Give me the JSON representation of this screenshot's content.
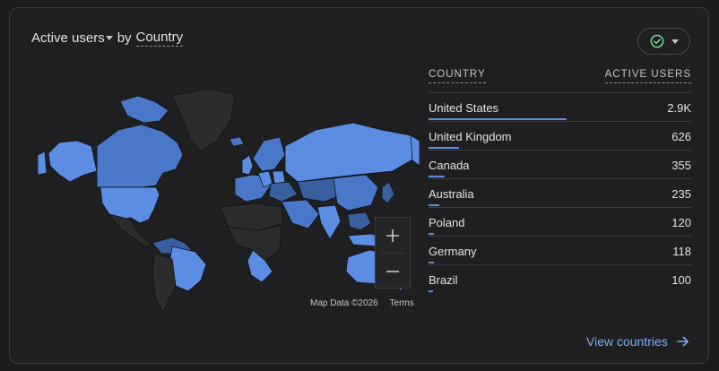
{
  "card": {
    "title": {
      "metric": "Active users",
      "connector": "by",
      "dimension": "Country"
    },
    "status_icon": "check-circle-icon"
  },
  "map": {
    "attribution": "Map Data ©2026",
    "terms_label": "Terms",
    "zoom_in_icon": "plus-icon",
    "zoom_out_icon": "minus-icon",
    "colors": {
      "ocean": "#1f1f21",
      "no_data": "#2a2c2e",
      "high": "#5b8de3",
      "mid": "#4a78c8",
      "low": "#3a5f9f",
      "border": "#111214"
    }
  },
  "table": {
    "headers": {
      "country": "COUNTRY",
      "users": "ACTIVE USERS"
    },
    "rows": [
      {
        "country": "United States",
        "value": "2.9K",
        "fraction": 1.0
      },
      {
        "country": "United Kingdom",
        "value": "626",
        "fraction": 0.22
      },
      {
        "country": "Canada",
        "value": "355",
        "fraction": 0.12
      },
      {
        "country": "Australia",
        "value": "235",
        "fraction": 0.08
      },
      {
        "country": "Poland",
        "value": "120",
        "fraction": 0.04
      },
      {
        "country": "Germany",
        "value": "118",
        "fraction": 0.04
      },
      {
        "country": "Brazil",
        "value": "100",
        "fraction": 0.035
      }
    ],
    "bar_color": "#5b8de3"
  },
  "footer": {
    "link_label": "View countries",
    "link_icon": "arrow-right-icon",
    "link_color": "#7aacff"
  }
}
